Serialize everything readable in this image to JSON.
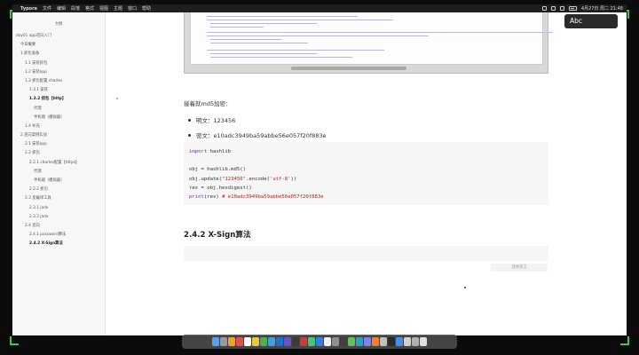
{
  "menubar": {
    "app_name": "Typora",
    "items": [
      "文件",
      "编辑",
      "段落",
      "格式",
      "视图",
      "主题",
      "窗口",
      "帮助"
    ],
    "clock": "4月27日 周二 21:48"
  },
  "ime": {
    "label": "Abc"
  },
  "sidebar": {
    "title": "大纲",
    "items": [
      {
        "label": "day01 app逆向入门",
        "level": 0,
        "active": false
      },
      {
        "label": "今日概要",
        "level": 1,
        "active": false
      },
      {
        "label": "1.抓包准备",
        "level": 1,
        "active": false
      },
      {
        "label": "1.1 安装抓包",
        "level": 2,
        "active": false
      },
      {
        "label": "1.2 安装app",
        "level": 2,
        "active": false
      },
      {
        "label": "1.3 抓包配置 charles",
        "level": 2,
        "active": false
      },
      {
        "label": "1.3.1 安装",
        "level": 3,
        "active": false
      },
      {
        "label": "1.3.2 抓包【http】",
        "level": 3,
        "active": true
      },
      {
        "label": "代理",
        "level": 4,
        "active": false
      },
      {
        "label": "手机端（模拟器）",
        "level": 4,
        "active": false
      },
      {
        "label": "1.4 补充",
        "level": 2,
        "active": false
      },
      {
        "label": "2.逆向案例实战",
        "level": 1,
        "active": false
      },
      {
        "label": "2.1 安装app",
        "level": 2,
        "active": false
      },
      {
        "label": "2.2 抓包",
        "level": 2,
        "active": false
      },
      {
        "label": "2.2.1 charles配置【https】",
        "level": 3,
        "active": false
      },
      {
        "label": "代理",
        "level": 4,
        "active": false
      },
      {
        "label": "手机端（模拟器）",
        "level": 4,
        "active": false
      },
      {
        "label": "2.2.2 抓包",
        "level": 3,
        "active": false
      },
      {
        "label": "2.3 反编译工具",
        "level": 2,
        "active": false
      },
      {
        "label": "2.3.1 jadx",
        "level": 3,
        "active": false
      },
      {
        "label": "2.3.2 jadx",
        "level": 3,
        "active": false
      },
      {
        "label": "2.4 逆向",
        "level": 2,
        "active": false
      },
      {
        "label": "2.4.1 password算法",
        "level": 3,
        "active": false
      },
      {
        "label": "2.4.2 X-Sign算法",
        "level": 3,
        "active": true
      }
    ]
  },
  "content": {
    "paragraph": "接着就md5加密：",
    "bullets": [
      "明文：123456",
      "密文：e10adc3949ba59abbe56e057f20f883e"
    ],
    "code_lines": [
      [
        {
          "t": "import",
          "c": "kw"
        },
        {
          "t": " hashlib",
          "c": "fn"
        }
      ],
      [],
      [
        {
          "t": "obj = hashlib.md5()",
          "c": "fn"
        }
      ],
      [
        {
          "t": "obj.update(",
          "c": "fn"
        },
        {
          "t": "\"123456\"",
          "c": "str"
        },
        {
          "t": ".encode(",
          "c": "fn"
        },
        {
          "t": "'utf-8'",
          "c": "str"
        },
        {
          "t": "))",
          "c": "fn"
        }
      ],
      [
        {
          "t": "res = obj.hexdigest()",
          "c": "fn"
        }
      ],
      [
        {
          "t": "print",
          "c": "kw"
        },
        {
          "t": "(res) ",
          "c": "fn"
        },
        {
          "t": "# e10adc3949ba59abbe56e057f20f883e",
          "c": "str"
        }
      ]
    ],
    "heading": "2.4.2 X-Sign算法",
    "lang_select_placeholder": "选择语言"
  },
  "dock": {
    "icons": [
      "#5aa0f0",
      "#9a9a9a",
      "#f0a030",
      "#e05050",
      "#ffffff",
      "#e8c840",
      "#50b050",
      "#40a0e0",
      "#2070d0",
      "#7050c0",
      "#3a3a3a",
      "#c04040",
      "#50c080",
      "#3080e0",
      "#f0f0f0",
      "#909090",
      "#404040",
      "#60c060",
      "#30a0c0",
      "#8080f0",
      "#f08030",
      "#c0c0c0",
      "#2a2a2a",
      "#4090f0",
      "#d0d0d0",
      "#b0b0b0",
      "#e0e0e0"
    ]
  }
}
